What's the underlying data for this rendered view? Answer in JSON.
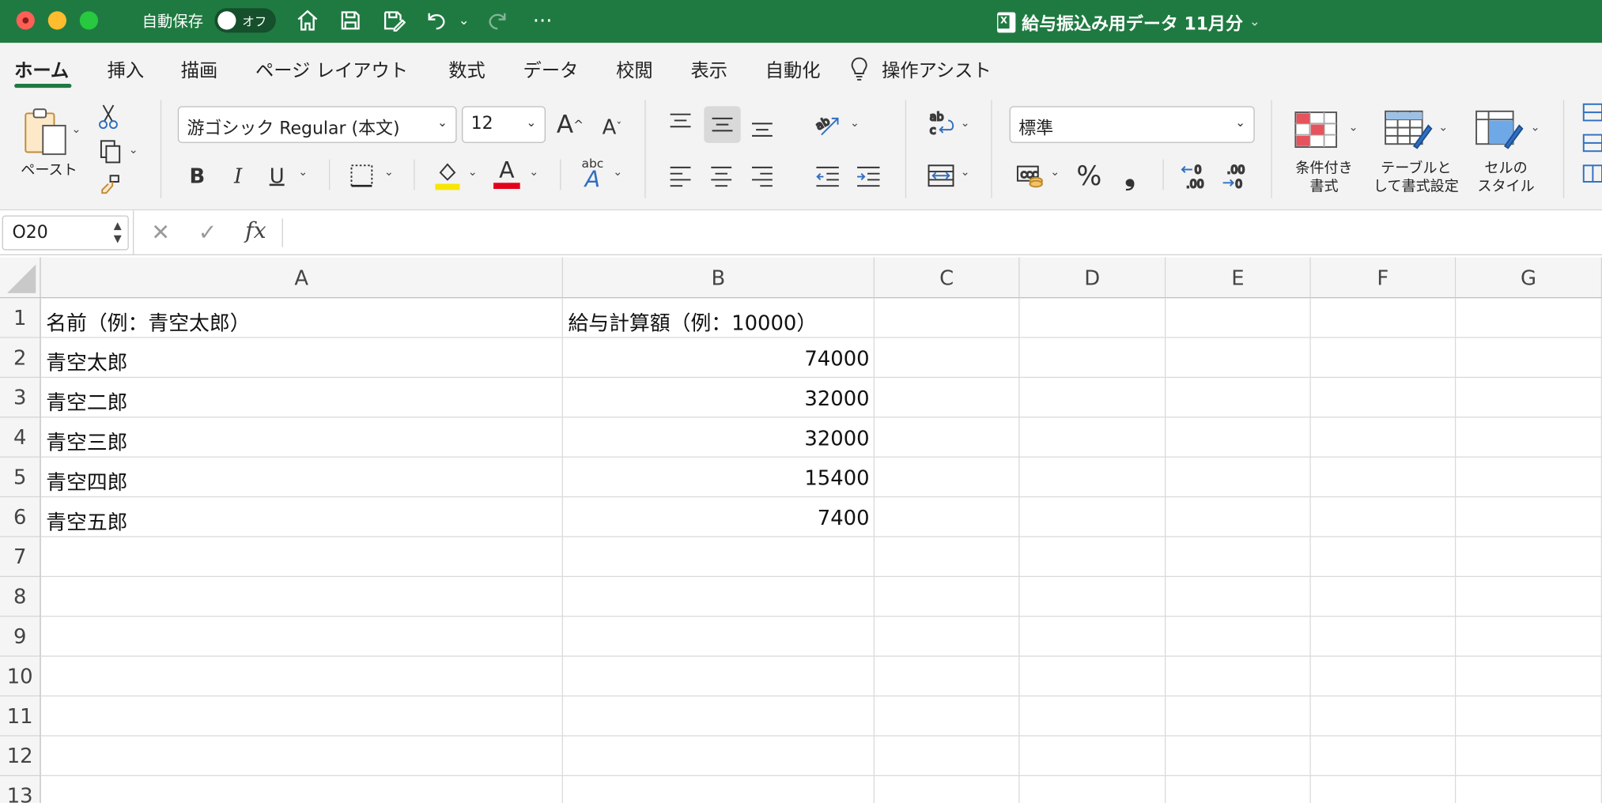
{
  "titlebar": {
    "autosave_label": "自動保存",
    "autosave_state": "オフ",
    "doc_title": "給与振込み用データ 11月分",
    "icons": [
      "home-icon",
      "save-icon",
      "save-as-icon",
      "undo-icon",
      "redo-icon",
      "more-icon"
    ]
  },
  "tabs": [
    "ホーム",
    "挿入",
    "描画",
    "ページ レイアウト",
    "数式",
    "データ",
    "校閲",
    "表示",
    "自動化",
    "操作アシスト"
  ],
  "active_tab": "ホーム",
  "ribbon": {
    "paste_label": "ペースト",
    "font_name": "游ゴシック Regular (本文)",
    "font_size": "12",
    "bold": "B",
    "italic": "I",
    "underline": "U",
    "font_color_letter": "A",
    "number_format": "標準",
    "percent": "%",
    "comma": "❟",
    "conditional_format_label_1": "条件付き",
    "conditional_format_label_2": "書式",
    "table_format_label_1": "テーブルと",
    "table_format_label_2": "して書式設定",
    "cell_style_label_1": "セルの",
    "cell_style_label_2": "スタイル",
    "highlight_color": "#f7e600",
    "font_color": "#e3001b"
  },
  "formula_bar": {
    "name_box": "O20",
    "fx": "fx",
    "formula": ""
  },
  "sheet": {
    "columns": [
      "A",
      "B",
      "C",
      "D",
      "E",
      "F",
      "G"
    ],
    "row_numbers": [
      "1",
      "2",
      "3",
      "4",
      "5",
      "6",
      "7",
      "8",
      "9",
      "10",
      "11",
      "12",
      "13"
    ],
    "rows": [
      {
        "a": "名前（例：青空太郎）",
        "b": "給与計算額（例：10000）"
      },
      {
        "a": "青空太郎",
        "b": "74000"
      },
      {
        "a": "青空二郎",
        "b": "32000"
      },
      {
        "a": "青空三郎",
        "b": "32000"
      },
      {
        "a": "青空四郎",
        "b": "15400"
      },
      {
        "a": "青空五郎",
        "b": "7400"
      }
    ]
  },
  "colors": {
    "titlebar": "#1f7a41",
    "ribbon_bg": "#f3f3f3"
  }
}
